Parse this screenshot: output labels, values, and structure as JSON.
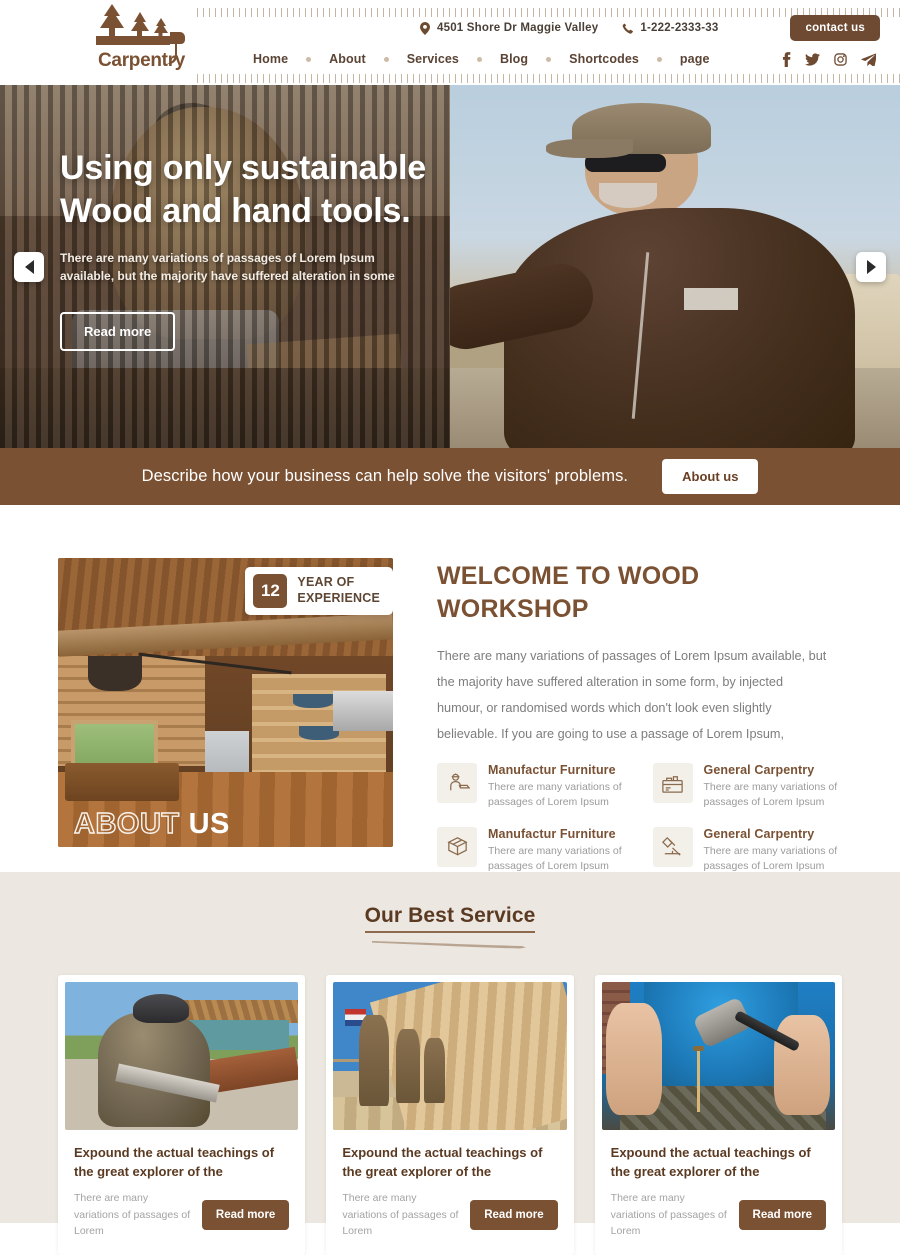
{
  "header": {
    "logo": {
      "text": "Carpentry",
      "icon": "trees-hammer-logo"
    },
    "topbar": {
      "address": "4501 Shore Dr Maggie Valley",
      "address_icon": "location-pin-icon",
      "phone": "1-222-2333-33",
      "phone_icon": "phone-icon",
      "contact_button": "contact us"
    },
    "nav": [
      {
        "label": "Home"
      },
      {
        "label": "About"
      },
      {
        "label": "Services"
      },
      {
        "label": "Blog"
      },
      {
        "label": "Shortcodes"
      },
      {
        "label": "page"
      }
    ],
    "social": [
      {
        "name": "facebook-icon"
      },
      {
        "name": "twitter-icon"
      },
      {
        "name": "instagram-icon"
      },
      {
        "name": "telegram-icon"
      }
    ]
  },
  "hero": {
    "title_line1": "Using only sustainable",
    "title_line2": "Wood and hand tools.",
    "subtitle": "There are many variations of passages of Lorem Ipsum available, but the majority have suffered alteration in some",
    "button": "Read more",
    "prev_label": "Previous slide",
    "next_label": "Next slide"
  },
  "cta": {
    "text": "Describe how your business can help solve the visitors' problems.",
    "button": "About us"
  },
  "welcome": {
    "badge": {
      "number": "12",
      "line1": "YEAR OF",
      "line2": "EXPERIENCE"
    },
    "image_overlay": {
      "outlined": "ABOUT",
      "solid": "US"
    },
    "title": "WELCOME TO WOOD WORKSHOP",
    "body": "There are many variations of passages of Lorem Ipsum available, but the majority have suffered alteration in some form, by injected humour, or randomised words which don't look even slightly believable. If you are going to use a passage of Lorem Ipsum,",
    "features": [
      {
        "icon": "worker-icon",
        "title": "Manufactur Furniture",
        "desc": "There are many variations of passages of Lorem Ipsum"
      },
      {
        "icon": "toolbox-icon",
        "title": "General Carpentry",
        "desc": "There are many variations of passages of Lorem Ipsum"
      },
      {
        "icon": "wood-plank-icon",
        "title": "Manufactur Furniture",
        "desc": "There are many variations of passages of Lorem Ipsum"
      },
      {
        "icon": "hammer-nail-icon",
        "title": "General Carpentry",
        "desc": "There are many variations of passages of Lorem Ipsum"
      }
    ]
  },
  "services": {
    "title": "Our Best Service",
    "cards": [
      {
        "image": "carpenter-sawing-board-photo",
        "heading": "Expound the actual teachings of the great explorer of the",
        "desc": "There are many variations of passages of Lorem",
        "button": "Read more"
      },
      {
        "image": "workers-raising-wall-frame-photo",
        "heading": "Expound the actual teachings of the great explorer of the",
        "desc": "There are many variations of passages of Lorem",
        "button": "Read more"
      },
      {
        "image": "hammer-and-nail-photo",
        "heading": "Expound the actual teachings of the great explorer of the",
        "desc": "There are many variations of passages of Lorem",
        "button": "Read more"
      }
    ]
  },
  "colors": {
    "brand_brown": "#7b5133",
    "dark_brown": "#6d4a31",
    "heading_brown": "#5b3a22",
    "services_bg": "#ece8e1",
    "muted_text": "#9b9b9b"
  }
}
